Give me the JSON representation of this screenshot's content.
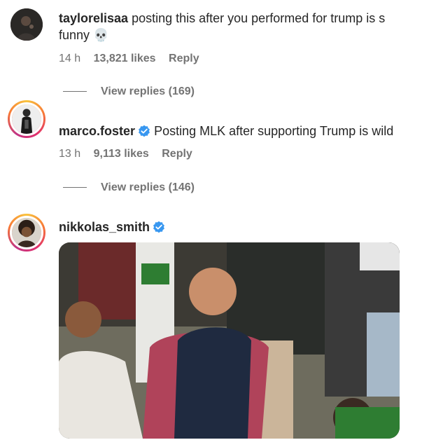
{
  "comments": [
    {
      "username": "taylorelisaa",
      "verified": false,
      "text_line1": "posting this after you performed for trump is s",
      "text_line2": "funny 💀",
      "time": "14 h",
      "likes": "13,821 likes",
      "reply": "Reply",
      "view_replies": "View replies (169)"
    },
    {
      "username": "marco.foster",
      "verified": true,
      "text_line1": "Posting MLK after supporting Trump is wild",
      "time": "13 h",
      "likes": "9,113 likes",
      "reply": "Reply",
      "view_replies": "View replies (146)"
    },
    {
      "username": "nikkolas_smith",
      "verified": true,
      "media": "gif-image"
    }
  ],
  "colors": {
    "text": "#262626",
    "secondary": "#737373",
    "verified_blue": "#3897f0"
  },
  "icons": {
    "verified": "verified-badge-icon"
  }
}
